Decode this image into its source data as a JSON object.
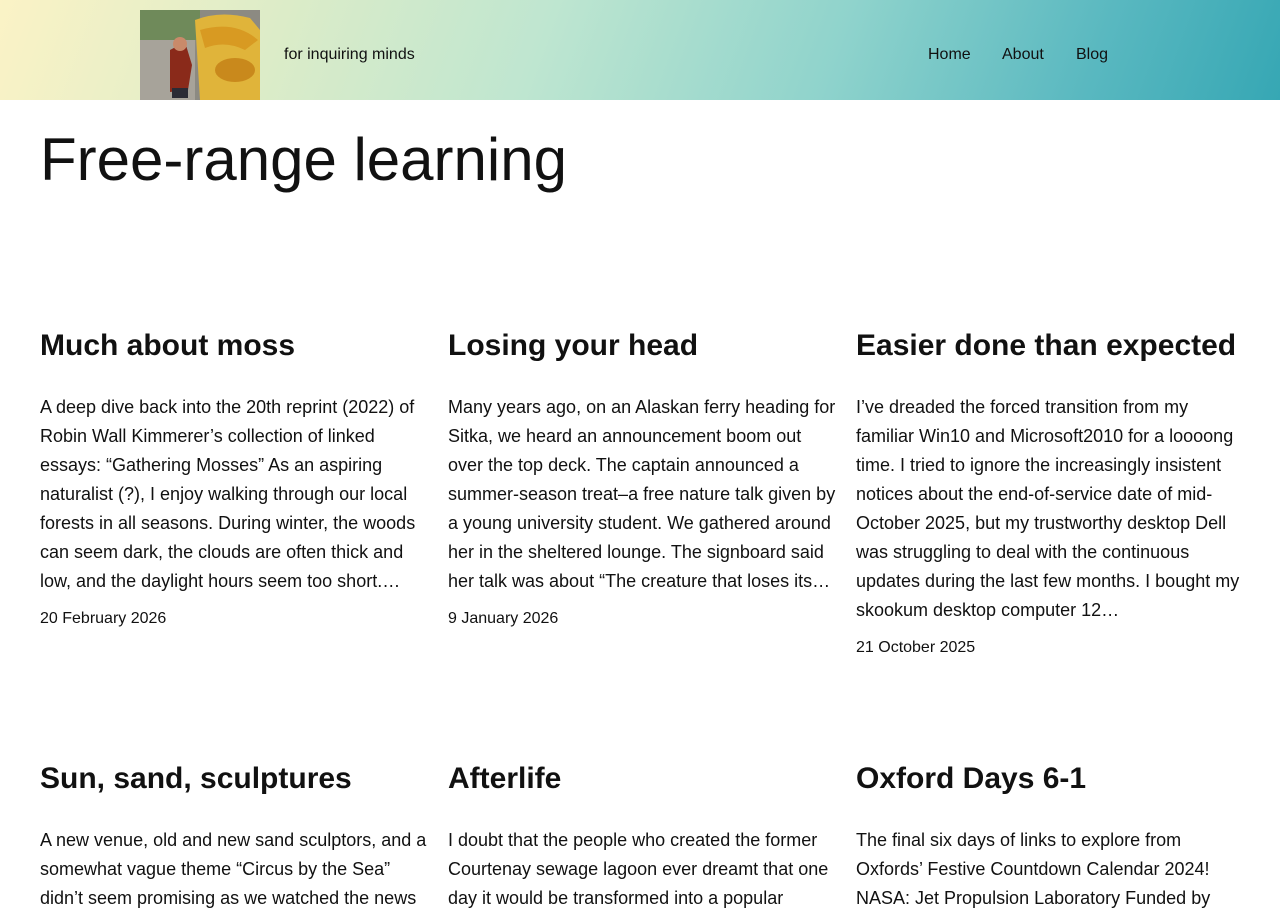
{
  "site": {
    "tagline": "for inquiring minds"
  },
  "nav": {
    "items": [
      {
        "label": "Home"
      },
      {
        "label": "About"
      },
      {
        "label": "Blog"
      }
    ]
  },
  "page": {
    "title": "Free-range learning"
  },
  "posts": [
    {
      "title": "Much about moss",
      "excerpt": "A deep dive back into the 20th reprint (2022) of Robin Wall Kimmerer’s collection of linked essays: “Gathering Mosses” As an aspiring naturalist (?), I enjoy walking through our local forests in all seasons. During winter, the woods can seem dark, the clouds are often thick and low, and the daylight hours seem too short.…",
      "date": "20 February 2026"
    },
    {
      "title": "Losing your head",
      "excerpt": "Many years ago, on an Alaskan ferry heading for Sitka, we heard an announcement boom out over the top deck. The captain announced a summer-season treat–a free nature talk given by a young university student. We gathered around her in the sheltered lounge. The signboard said her talk was about “The creature that loses its…",
      "date": "9 January 2026"
    },
    {
      "title": "Easier done than expected",
      "excerpt": "I’ve dreaded the forced transition from my familiar Win10 and Microsoft2010 for a loooong time. I tried to ignore the increasingly insistent notices about the end-of-service date of mid-October 2025, but my trustworthy desktop Dell was struggling to deal with the continuous updates during the last few months. I bought my skookum desktop computer 12…",
      "date": "21 October 2025"
    },
    {
      "title": "Sun, sand, sculptures",
      "excerpt": "A new venue, old and new sand sculptors, and a somewhat vague theme “Circus by the Sea” didn’t seem promising as we watched the news",
      "date": ""
    },
    {
      "title": "Afterlife",
      "excerpt": "I doubt that the people who created the former Courtenay sewage lagoon ever dreamt that one day it would be transformed into a popular",
      "date": ""
    },
    {
      "title": "Oxford Days 6-1",
      "excerpt": "The final six days of links to explore from Oxfords’ Festive Countdown Calendar 2024! NASA: Jet Propulsion Laboratory Funded by",
      "date": ""
    }
  ]
}
